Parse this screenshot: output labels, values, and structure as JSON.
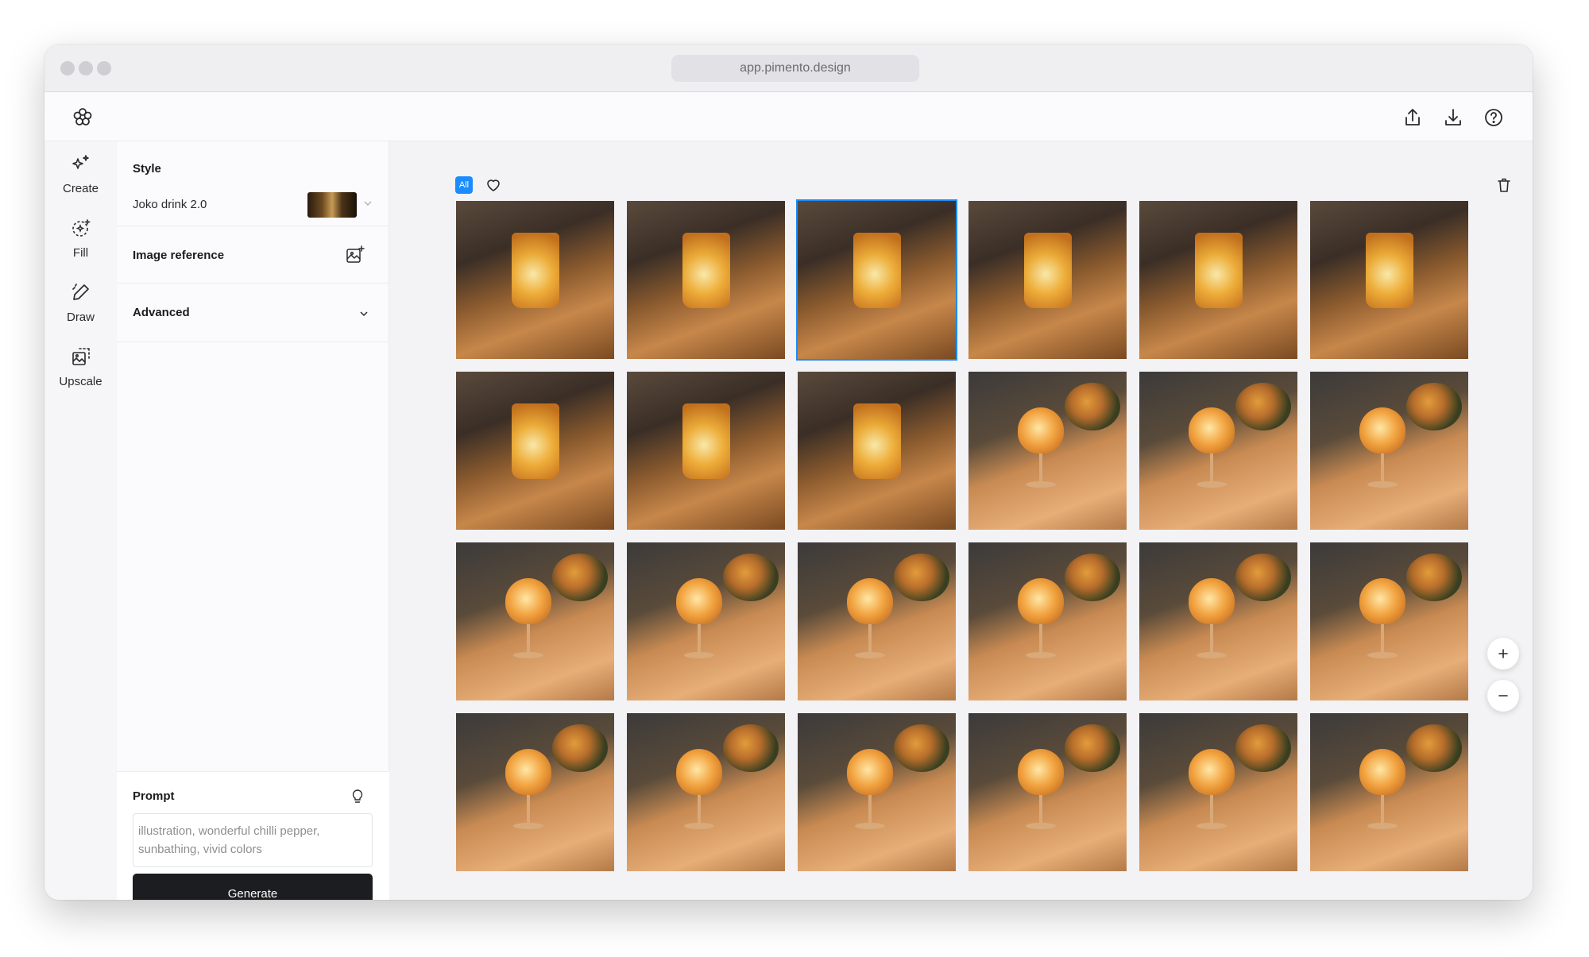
{
  "browser": {
    "url": "app.pimento.design"
  },
  "header": {
    "share": "share-icon",
    "download": "download-icon",
    "help": "help-icon"
  },
  "rail": [
    {
      "label": "Create",
      "icon": "sparkles-icon"
    },
    {
      "label": "Fill",
      "icon": "fill-icon"
    },
    {
      "label": "Draw",
      "icon": "pen-icon"
    },
    {
      "label": "Upscale",
      "icon": "upscale-icon"
    }
  ],
  "panel": {
    "style_title": "Style",
    "style_value": "Joko drink 2.0",
    "image_reference": "Image reference",
    "advanced": "Advanced",
    "prompt_title": "Prompt",
    "prompt_placeholder": "illustration, wonderful chilli pepper, sunbathing, vivid colors",
    "generate": "Generate"
  },
  "canvas": {
    "filter_all": "All",
    "selected_index": 2,
    "tiles": [
      "a",
      "a",
      "a",
      "a",
      "a",
      "a",
      "a",
      "a",
      "a",
      "b",
      "b",
      "b",
      "b",
      "b",
      "b",
      "b",
      "b",
      "b",
      "b",
      "b",
      "b",
      "b",
      "b",
      "b"
    ]
  },
  "colors": {
    "accent": "#1a8cff",
    "button": "#1c1d20"
  }
}
